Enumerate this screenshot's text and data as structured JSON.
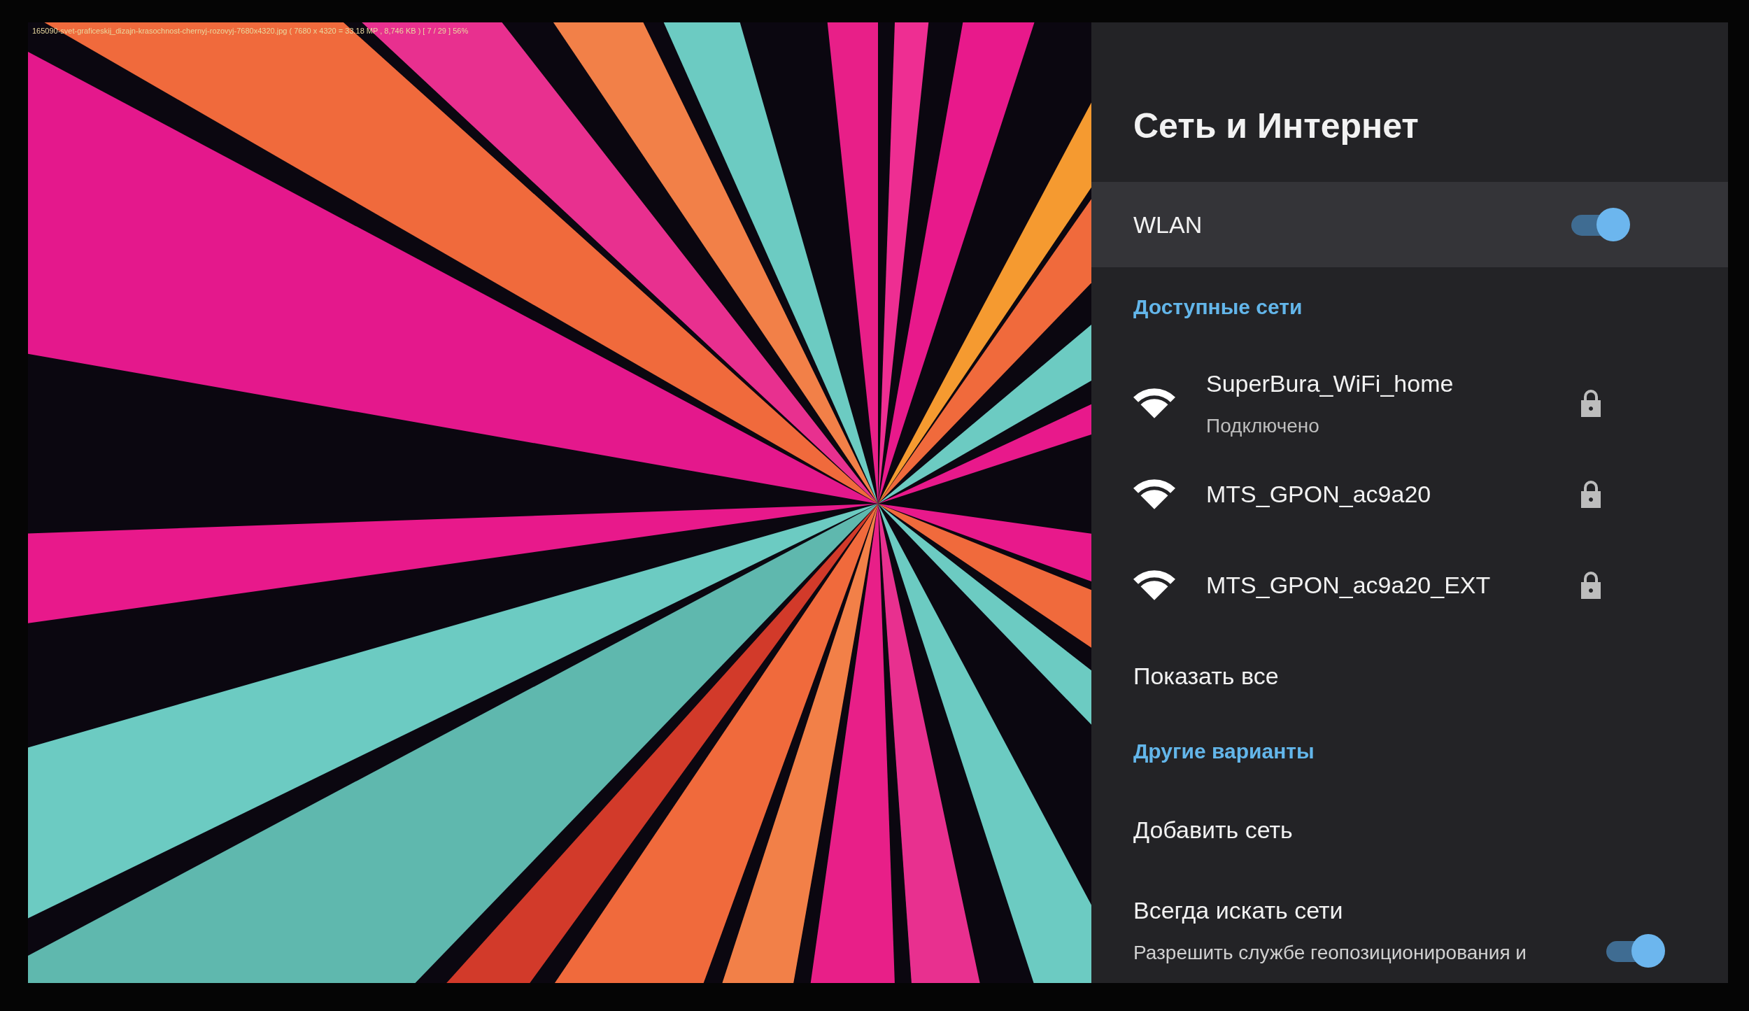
{
  "viewer_caption": "165090-svet-graficeskij_dizajn-krasochnost-chernyj-rozovyj-7680x4320.jpg ( 7680 x 4320 = 33.18 MP , 8,746 KB ) [ 7 / 29 ] 56%",
  "title": "Сеть и Интернет",
  "wlan": {
    "label": "WLAN",
    "on": true
  },
  "available_header": "Доступные сети",
  "networks": [
    {
      "name": "SuperBura_WiFi_home",
      "status": "Подключено",
      "locked": true
    },
    {
      "name": "MTS_GPON_ac9a20",
      "locked": true
    },
    {
      "name": "MTS_GPON_ac9a20_EXT",
      "locked": true
    }
  ],
  "show_all": "Показать все",
  "other_header": "Другие варианты",
  "add_network": "Добавить сеть",
  "always_scan": {
    "label": "Всегда искать сети",
    "description": "Разрешить службе геопозиционирования и",
    "on": true
  }
}
